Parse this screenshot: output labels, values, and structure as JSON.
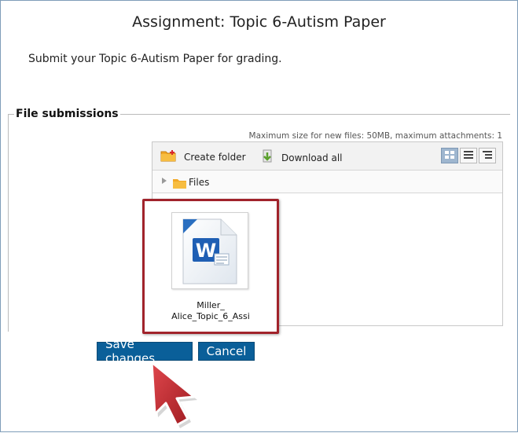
{
  "page": {
    "title": "Assignment: Topic 6-Autism Paper",
    "intro": "Submit your Topic 6-Autism Paper for grading."
  },
  "file_submissions": {
    "legend": "File submissions",
    "max_size_text": "Maximum size for new files: 50MB, maximum attachments: 1",
    "toolbar": {
      "create_folder": "Create folder",
      "download_all": "Download all"
    },
    "path": "Files",
    "files": [
      {
        "name_line1": "Miller_",
        "name_line2": "Alice_Topic_6_Assi",
        "icon": "word-document-icon"
      }
    ]
  },
  "buttons": {
    "save": "Save changes",
    "cancel": "Cancel"
  },
  "colors": {
    "button_bg": "#0a5f99",
    "highlight_border": "#a1232b",
    "cursor_red": "#c1272d"
  }
}
